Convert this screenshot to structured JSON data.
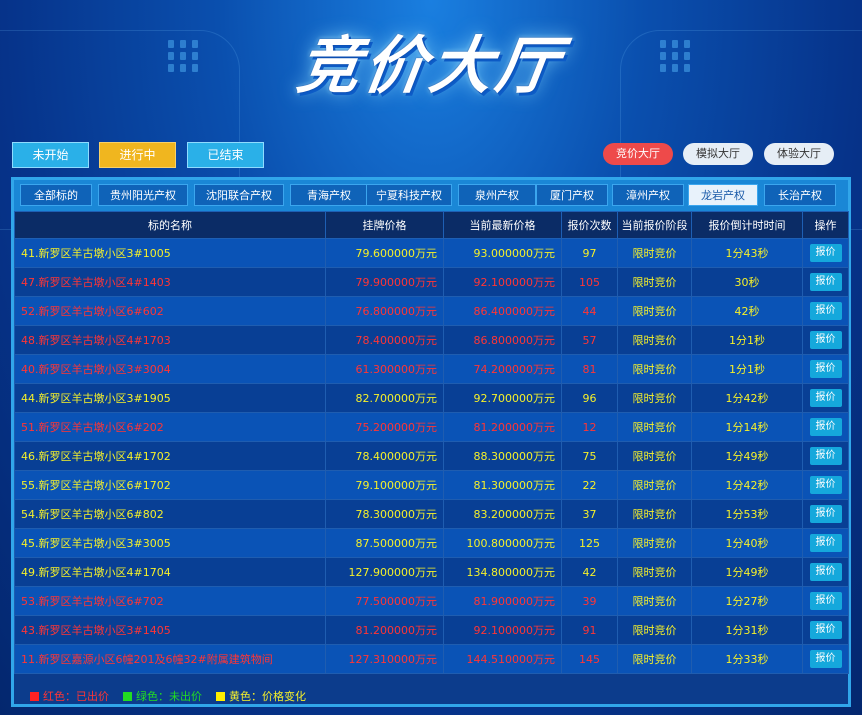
{
  "banner": {
    "title": "竞价大厅"
  },
  "status_tabs": [
    {
      "label": "未开始"
    },
    {
      "label": "进行中"
    },
    {
      "label": "已结束"
    }
  ],
  "hall_buttons": [
    {
      "label": "竞价大厅"
    },
    {
      "label": "模拟大厅"
    },
    {
      "label": "体验大厅"
    }
  ],
  "region_tabs": [
    {
      "label": "全部标的"
    },
    {
      "label": "贵州阳光产权"
    },
    {
      "label": "沈阳联合产权"
    },
    {
      "label": "青海产权"
    },
    {
      "label": "宁夏科技产权"
    },
    {
      "label": "泉州产权"
    },
    {
      "label": "厦门产权"
    },
    {
      "label": "漳州产权"
    },
    {
      "label": "龙岩产权"
    },
    {
      "label": "长治产权"
    }
  ],
  "table": {
    "headers": [
      "标的名称",
      "挂牌价格",
      "当前最新价格",
      "报价次数",
      "当前报价阶段",
      "报价倒计时时间",
      "操作"
    ],
    "rows": [
      {
        "name": "41.新罗区羊古墩小区3#1005",
        "list": "79.600000万元",
        "latest": "93.000000万元",
        "count": "97",
        "stage": "限时竞价",
        "countdown": "1分43秒",
        "action": "报价",
        "color": "yellow"
      },
      {
        "name": "47.新罗区羊古墩小区4#1403",
        "list": "79.900000万元",
        "latest": "92.100000万元",
        "count": "105",
        "stage": "限时竞价",
        "countdown": "30秒",
        "action": "报价",
        "color": "red"
      },
      {
        "name": "52.新罗区羊古墩小区6#602",
        "list": "76.800000万元",
        "latest": "86.400000万元",
        "count": "44",
        "stage": "限时竞价",
        "countdown": "42秒",
        "action": "报价",
        "color": "red"
      },
      {
        "name": "48.新罗区羊古墩小区4#1703",
        "list": "78.400000万元",
        "latest": "86.800000万元",
        "count": "57",
        "stage": "限时竞价",
        "countdown": "1分1秒",
        "action": "报价",
        "color": "red"
      },
      {
        "name": "40.新罗区羊古墩小区3#3004",
        "list": "61.300000万元",
        "latest": "74.200000万元",
        "count": "81",
        "stage": "限时竞价",
        "countdown": "1分1秒",
        "action": "报价",
        "color": "red"
      },
      {
        "name": "44.新罗区羊古墩小区3#1905",
        "list": "82.700000万元",
        "latest": "92.700000万元",
        "count": "96",
        "stage": "限时竞价",
        "countdown": "1分42秒",
        "action": "报价",
        "color": "yellow"
      },
      {
        "name": "51.新罗区羊古墩小区6#202",
        "list": "75.200000万元",
        "latest": "81.200000万元",
        "count": "12",
        "stage": "限时竞价",
        "countdown": "1分14秒",
        "action": "报价",
        "color": "red"
      },
      {
        "name": "46.新罗区羊古墩小区4#1702",
        "list": "78.400000万元",
        "latest": "88.300000万元",
        "count": "75",
        "stage": "限时竞价",
        "countdown": "1分49秒",
        "action": "报价",
        "color": "yellow"
      },
      {
        "name": "55.新罗区羊古墩小区6#1702",
        "list": "79.100000万元",
        "latest": "81.300000万元",
        "count": "22",
        "stage": "限时竞价",
        "countdown": "1分42秒",
        "action": "报价",
        "color": "yellow"
      },
      {
        "name": "54.新罗区羊古墩小区6#802",
        "list": "78.300000万元",
        "latest": "83.200000万元",
        "count": "37",
        "stage": "限时竞价",
        "countdown": "1分53秒",
        "action": "报价",
        "color": "yellow"
      },
      {
        "name": "45.新罗区羊古墩小区3#3005",
        "list": "87.500000万元",
        "latest": "100.800000万元",
        "count": "125",
        "stage": "限时竞价",
        "countdown": "1分40秒",
        "action": "报价",
        "color": "yellow"
      },
      {
        "name": "49.新罗区羊古墩小区4#1704",
        "list": "127.900000万元",
        "latest": "134.800000万元",
        "count": "42",
        "stage": "限时竞价",
        "countdown": "1分49秒",
        "action": "报价",
        "color": "yellow"
      },
      {
        "name": "53.新罗区羊古墩小区6#702",
        "list": "77.500000万元",
        "latest": "81.900000万元",
        "count": "39",
        "stage": "限时竞价",
        "countdown": "1分27秒",
        "action": "报价",
        "color": "red"
      },
      {
        "name": "43.新罗区羊古墩小区3#1405",
        "list": "81.200000万元",
        "latest": "92.100000万元",
        "count": "91",
        "stage": "限时竞价",
        "countdown": "1分31秒",
        "action": "报价",
        "color": "red"
      },
      {
        "name": "11.新罗区嘉源小区6幢201及6幢32#附属建筑物间",
        "list": "127.310000万元",
        "latest": "144.510000万元",
        "count": "145",
        "stage": "限时竞价",
        "countdown": "1分33秒",
        "action": "报价",
        "color": "red"
      }
    ]
  },
  "legend": [
    {
      "label": "红色：已出价",
      "color": "#ff2222"
    },
    {
      "label": "绿色：未出价",
      "color": "#22dd22"
    },
    {
      "label": "黄色：价格变化",
      "color": "#ffee00"
    }
  ]
}
